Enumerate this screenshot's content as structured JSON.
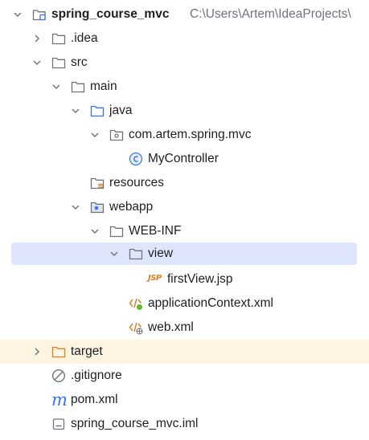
{
  "project": {
    "name": "spring_course_mvc",
    "path": "C:\\Users\\Artem\\IdeaProjects\\"
  },
  "tree": {
    "idea": ".idea",
    "src": "src",
    "main": "main",
    "java": "java",
    "package": "com.artem.spring.mvc",
    "controller": "MyController",
    "resources": "resources",
    "webapp": "webapp",
    "webinf": "WEB-INF",
    "view": "view",
    "jsp_file": "firstView.jsp",
    "app_context": "applicationContext.xml",
    "web_xml": "web.xml",
    "target": "target",
    "gitignore": ".gitignore",
    "pom": "pom.xml",
    "iml": "spring_course_mvc.iml"
  },
  "icons": {
    "jsp_badge": "JSP",
    "maven_badge": "m"
  },
  "colors": {
    "selection": "#dfe6fb",
    "excluded_highlight": "#fdf4e1",
    "folder_blue": "#3574f0",
    "excluded_orange": "#d9822b",
    "text_muted": "#6f737a"
  }
}
